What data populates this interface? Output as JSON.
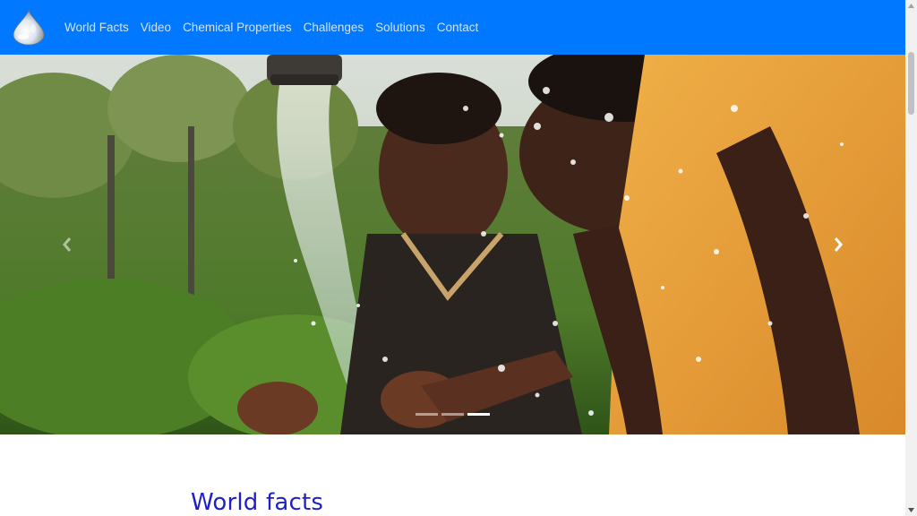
{
  "navbar": {
    "brand_icon": "water-drop-icon",
    "links": [
      "World Facts",
      "Video",
      "Chemical Properties",
      "Challenges",
      "Solutions",
      "Contact"
    ],
    "background": "#0078ff",
    "link_color": "#cfe3ff"
  },
  "carousel": {
    "image": "children-washing-hands-under-tap-water",
    "prev_icon": "chevron-left-icon",
    "next_icon": "chevron-right-icon",
    "slide_count": 3,
    "active_slide": 3
  },
  "section": {
    "title": "World facts",
    "title_color": "#1f1fc9"
  }
}
